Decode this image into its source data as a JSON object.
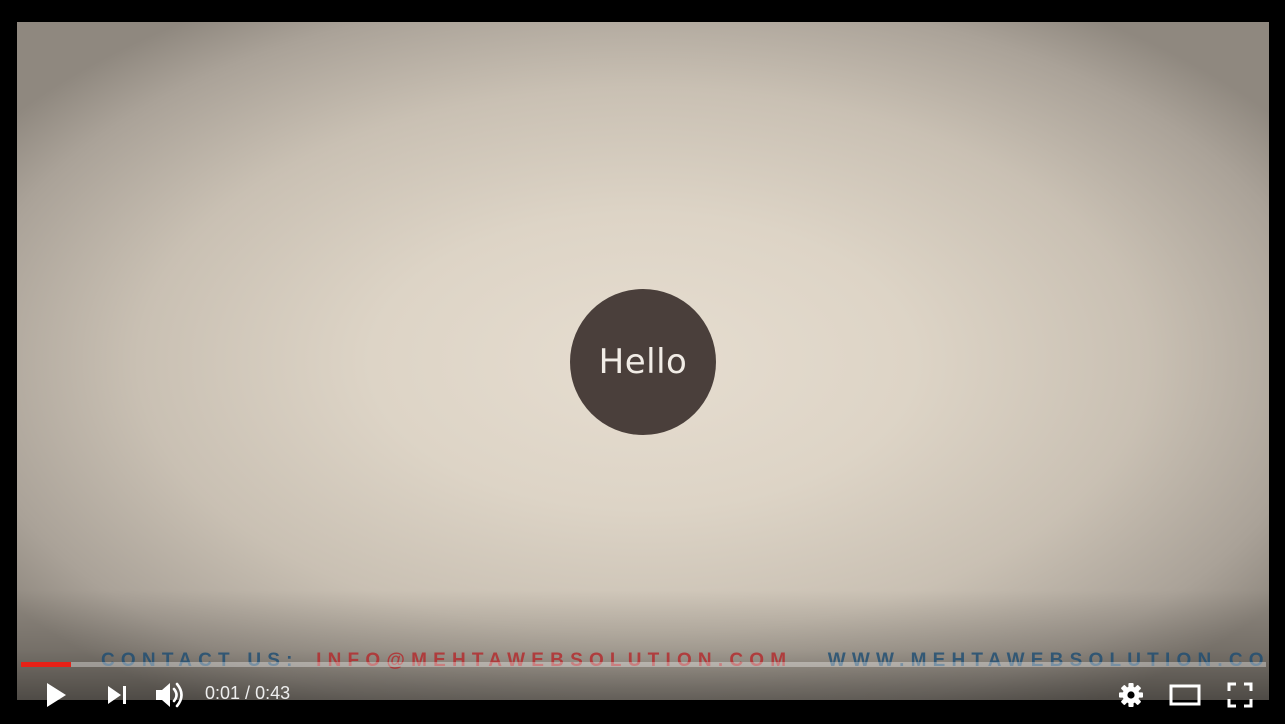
{
  "video": {
    "center_text": "Hello",
    "ticker": {
      "contact_label": "CONTACT US:",
      "email": "INFO@MEHTAWEBSOLUTION.COM",
      "website": "WWW.MEHTAWEBSOLUTION.COM"
    }
  },
  "player": {
    "progress_fraction": 0.04,
    "progress_color": "#e62117",
    "time_current": "0:01",
    "time_separator": " / ",
    "time_total": "0:43",
    "icons": {
      "play": "play-icon",
      "next": "next-icon",
      "volume": "volume-icon",
      "settings": "gear-icon",
      "theater": "theater-mode-icon",
      "fullscreen": "fullscreen-icon"
    }
  }
}
